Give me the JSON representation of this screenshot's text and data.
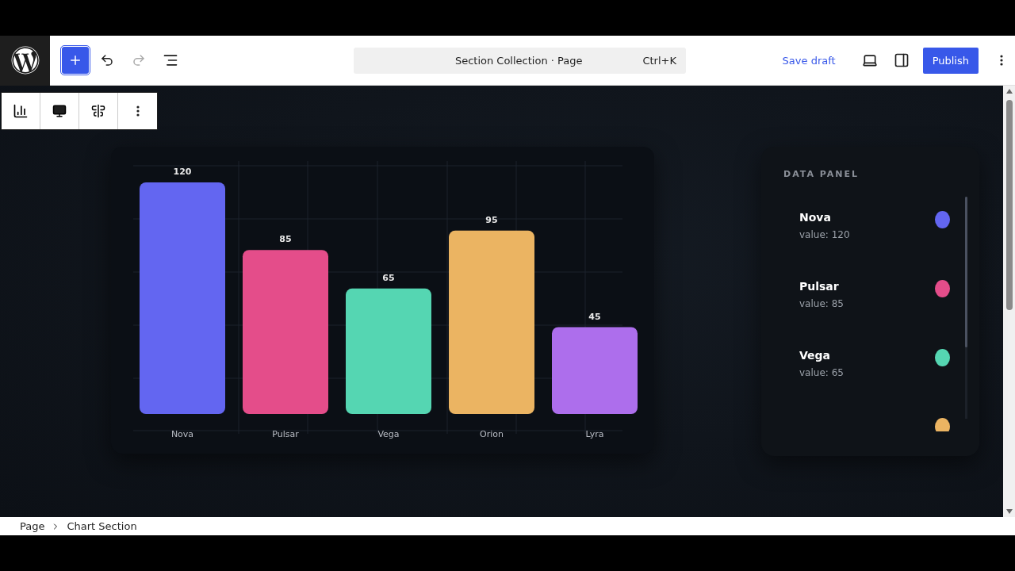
{
  "header": {
    "command_bar": {
      "title": "Section Collection · Page",
      "shortcut": "Ctrl+K"
    },
    "save_draft": "Save draft",
    "publish": "Publish"
  },
  "chart_card": {
    "chart_data": {
      "type": "bar",
      "categories": [
        "Nova",
        "Pulsar",
        "Vega",
        "Orion",
        "Lyra"
      ],
      "values": [
        120,
        85,
        65,
        95,
        45
      ],
      "colors": [
        "#6366f1",
        "#e44d8a",
        "#55d6b2",
        "#ebb462",
        "#ad6eec"
      ],
      "data_labels": true
    }
  },
  "data_panel": {
    "title": "DATA PANEL",
    "items": [
      {
        "name": "Nova",
        "value": "value: 120",
        "color": "#6366f1"
      },
      {
        "name": "Pulsar",
        "value": "value: 85",
        "color": "#e44d8a"
      },
      {
        "name": "Vega",
        "value": "value: 65",
        "color": "#55d6b2"
      },
      {
        "color": "#ebb462"
      }
    ]
  },
  "breadcrumb": [
    "Page",
    "Chart Section"
  ]
}
